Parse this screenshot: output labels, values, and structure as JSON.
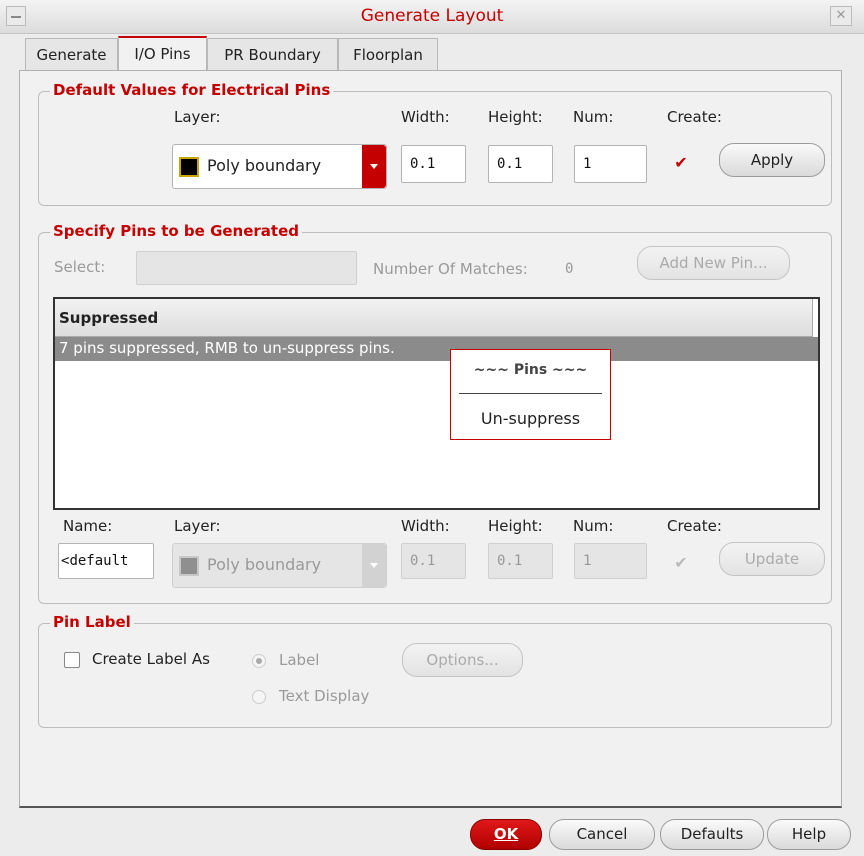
{
  "window": {
    "title": "Generate Layout",
    "close_icon": "close-icon"
  },
  "tabs": [
    {
      "label": "Generate",
      "active": false
    },
    {
      "label": "I/O Pins",
      "active": true
    },
    {
      "label": "PR Boundary",
      "active": false
    },
    {
      "label": "Floorplan",
      "active": false
    }
  ],
  "defaults": {
    "title": "Default Values for Electrical Pins",
    "layer_label": "Layer:",
    "width_label": "Width:",
    "height_label": "Height:",
    "num_label": "Num:",
    "create_label": "Create:",
    "layer_value": "Poly boundary",
    "width_value": "0.1",
    "height_value": "0.1",
    "num_value": "1",
    "create_checked": true,
    "apply_label": "Apply"
  },
  "specify": {
    "title": "Specify Pins to be Generated",
    "select_label": "Select:",
    "select_value": "",
    "matches_label": "Number Of Matches:",
    "matches_value": "0",
    "add_pin_label": "Add New Pin...",
    "table_header": "Suppressed",
    "table_row": "7 pins suppressed, RMB to un-suppress pins.",
    "popup": {
      "title": "~~~ Pins ~~~",
      "item": "Un-suppress"
    },
    "name_label": "Name:",
    "layer_label": "Layer:",
    "width_label": "Width:",
    "height_label": "Height:",
    "num_label": "Num:",
    "create_label": "Create:",
    "name_value": "default>",
    "layer_value": "Poly boundary",
    "width_value": "0.1",
    "height_value": "0.1",
    "num_value": "1",
    "create_checked": true,
    "update_label": "Update"
  },
  "pin_label": {
    "title": "Pin Label",
    "create_label_as": "Create Label As",
    "radio_label": "Label",
    "radio_text_display": "Text Display",
    "options_label": "Options..."
  },
  "footer": {
    "ok": "OK",
    "cancel": "Cancel",
    "defaults": "Defaults",
    "help": "Help"
  },
  "colors": {
    "accent": "#c40000"
  }
}
